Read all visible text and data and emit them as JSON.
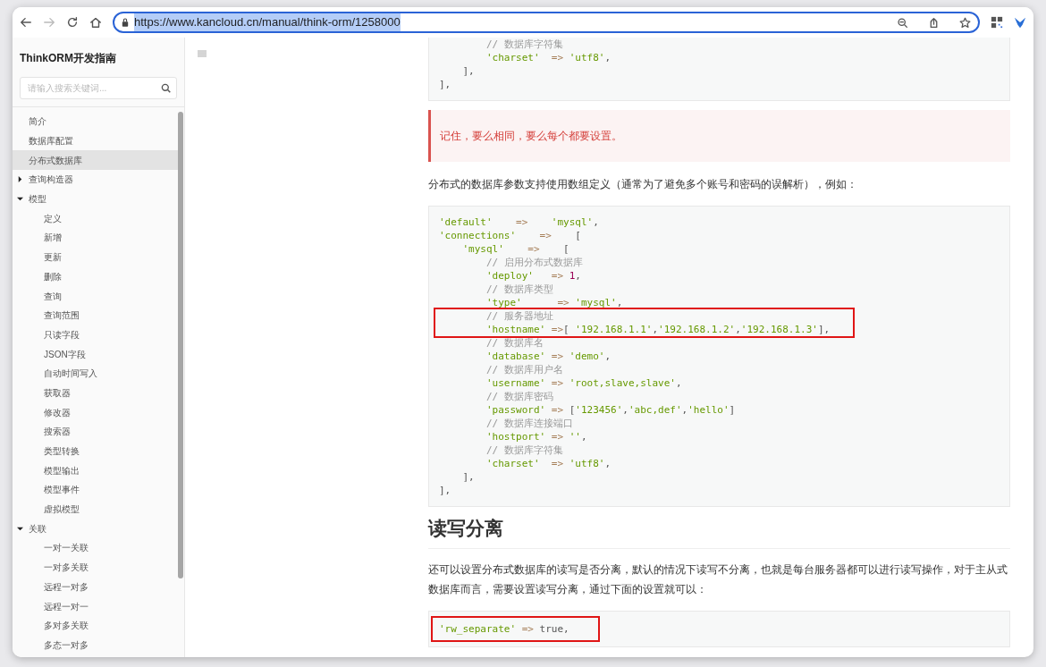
{
  "browser": {
    "url": "https://www.kancloud.cn/manual/think-orm/1258000",
    "url_selected": true
  },
  "sidebar": {
    "title": "ThinkORM开发指南",
    "search": {
      "placeholder": "请输入搜索关键词..."
    },
    "items": [
      {
        "label": "简介",
        "selected": false
      },
      {
        "label": "数据库配置",
        "selected": false
      },
      {
        "label": "分布式数据库",
        "selected": true
      },
      {
        "label": "查询构造器",
        "selected": false,
        "expanded": false
      },
      {
        "label": "模型",
        "selected": false,
        "expanded": true,
        "children": [
          {
            "label": "定义",
            "selected": false
          },
          {
            "label": "新增",
            "selected": false
          },
          {
            "label": "更新",
            "selected": false
          },
          {
            "label": "删除",
            "selected": false
          },
          {
            "label": "查询",
            "selected": false
          },
          {
            "label": "查询范围",
            "selected": false
          },
          {
            "label": "只读字段",
            "selected": false
          },
          {
            "label": "JSON字段",
            "selected": false
          },
          {
            "label": "自动时间写入",
            "selected": false
          },
          {
            "label": "获取器",
            "selected": false
          },
          {
            "label": "修改器",
            "selected": false
          },
          {
            "label": "搜索器",
            "selected": false
          },
          {
            "label": "类型转换",
            "selected": false
          },
          {
            "label": "模型输出",
            "selected": false
          },
          {
            "label": "模型事件",
            "selected": false
          },
          {
            "label": "虚拟模型",
            "selected": false
          }
        ]
      },
      {
        "label": "关联",
        "selected": false,
        "expanded": true,
        "children": [
          {
            "label": "一对一关联",
            "selected": false
          },
          {
            "label": "一对多关联",
            "selected": false
          },
          {
            "label": "远程一对多",
            "selected": false
          },
          {
            "label": "远程一对一",
            "selected": false
          },
          {
            "label": "多对多关联",
            "selected": false
          },
          {
            "label": "多态一对多",
            "selected": false
          }
        ]
      }
    ]
  },
  "content": {
    "blocks": [
      {
        "kind": "code",
        "lines": [
          {
            "text": "        // 数据库字符集",
            "boxed": false
          },
          {
            "text": "        'charset'  => 'utf8',",
            "boxed": false
          },
          {
            "text": "    ],",
            "boxed": false
          },
          {
            "text": "],",
            "boxed": false
          }
        ]
      },
      {
        "kind": "alert",
        "text": "记住，要么相同，要么每个都要设置。"
      },
      {
        "kind": "paragraph",
        "text": "分布式的数据库参数支持使用数组定义（通常为了避免多个账号和密码的误解析），例如："
      },
      {
        "kind": "code",
        "lines": [
          {
            "text": "'default'    =>    'mysql',",
            "boxed": false
          },
          {
            "text": "'connections'    =>    [",
            "boxed": false
          },
          {
            "text": "    'mysql'    =>    [",
            "boxed": false
          },
          {
            "text": "        // 启用分布式数据库",
            "boxed": false
          },
          {
            "text": "        'deploy'   => 1,",
            "boxed": false
          },
          {
            "text": "        // 数据库类型",
            "boxed": false
          },
          {
            "text": "        'type'      => 'mysql',",
            "boxed": false
          },
          {
            "text": "        // 服务器地址",
            "boxed": true
          },
          {
            "text": "        'hostname' =>[ '192.168.1.1','192.168.1.2','192.168.1.3'],",
            "boxed": true
          },
          {
            "text": "        // 数据库名",
            "boxed": false
          },
          {
            "text": "        'database' => 'demo',",
            "boxed": false
          },
          {
            "text": "        // 数据库用户名",
            "boxed": false
          },
          {
            "text": "        'username' => 'root,slave,slave',",
            "boxed": false
          },
          {
            "text": "        // 数据库密码",
            "boxed": false
          },
          {
            "text": "        'password' => ['123456','abc,def','hello']",
            "boxed": false
          },
          {
            "text": "        // 数据库连接端口",
            "boxed": false
          },
          {
            "text": "        'hostport' => '',",
            "boxed": false
          },
          {
            "text": "        // 数据库字符集",
            "boxed": false
          },
          {
            "text": "        'charset'  => 'utf8',",
            "boxed": false
          },
          {
            "text": "    ],",
            "boxed": false
          },
          {
            "text": "],",
            "boxed": false
          }
        ]
      },
      {
        "kind": "heading",
        "text": "读写分离"
      },
      {
        "kind": "paragraph",
        "text": "还可以设置分布式数据库的读写是否分离，默认的情况下读写不分离，也就是每台服务器都可以进行读写操作，对于主从式数据库而言，需要设置读写分离，通过下面的设置就可以："
      },
      {
        "kind": "code",
        "lines": [
          {
            "text": "'rw_separate' => true,",
            "boxed": true
          }
        ]
      }
    ]
  }
}
